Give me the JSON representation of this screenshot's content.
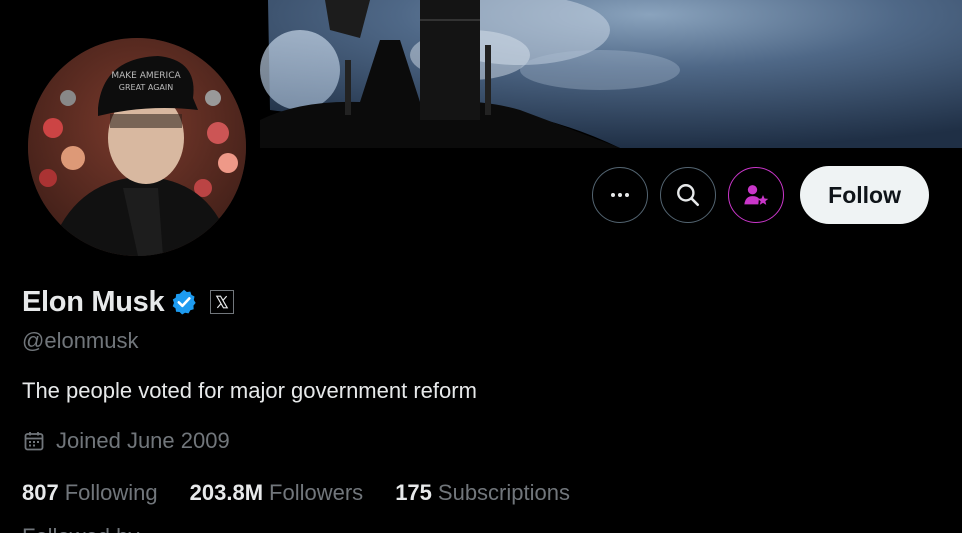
{
  "profile": {
    "name": "Elon Musk",
    "handle": "@elonmusk",
    "bio": "The people voted for major government reform",
    "joined": "Joined June 2009",
    "avatar_cap_text": "MAKE AMERICA GREAT AGAIN"
  },
  "actions": {
    "follow_label": "Follow"
  },
  "stats": {
    "following_count": "807",
    "following_label": "Following",
    "followers_count": "203.8M",
    "followers_label": "Followers",
    "subscriptions_count": "175",
    "subscriptions_label": "Subscriptions"
  },
  "cutoff_line": "Followed by ...",
  "icons": {
    "verified": "verified-badge-icon",
    "affiliate": "x-logo-icon",
    "more": "more-icon",
    "search": "search-icon",
    "subscribe": "subscribe-icon",
    "calendar": "calendar-icon"
  },
  "colors": {
    "verified_blue": "#1d9bf0",
    "subscribe_pink": "#c936c9",
    "secondary_text": "#71767b"
  }
}
